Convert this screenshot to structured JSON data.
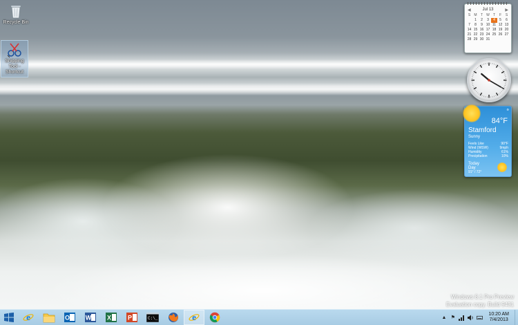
{
  "desktop": {
    "icons": [
      {
        "label": "Recycle Bin",
        "icon": "recycle-bin-icon"
      },
      {
        "label": "Snipping Tool - Shortcut",
        "icon": "snipping-tool-icon"
      }
    ]
  },
  "gadgets": {
    "calendar": {
      "month": "Jul 13",
      "weekdays": [
        "S",
        "M",
        "T",
        "W",
        "T",
        "F",
        "S"
      ],
      "days": [
        "",
        "1",
        "2",
        "3",
        "4",
        "5",
        "6",
        "7",
        "8",
        "9",
        "10",
        "11",
        "12",
        "13",
        "14",
        "15",
        "16",
        "17",
        "18",
        "19",
        "20",
        "21",
        "22",
        "23",
        "24",
        "25",
        "26",
        "27",
        "28",
        "29",
        "30",
        "31",
        "",
        "",
        ""
      ],
      "today": "4",
      "accent": "#e8731a"
    },
    "clock": {
      "hour": 10,
      "minute": 20
    },
    "weather": {
      "temperature": "84°F",
      "city": "Stamford",
      "condition": "Sunny",
      "details": [
        {
          "label": "Feels Like",
          "value": "90°F"
        },
        {
          "label": "Wind (WSW)",
          "value": "9mph"
        },
        {
          "label": "Humidity",
          "value": "61%"
        },
        {
          "label": "Precipitation",
          "value": "10%"
        }
      ],
      "forecast_label": "Today",
      "forecast_sub": "Day",
      "forecast_range": "91° / 72°"
    }
  },
  "watermark": {
    "line1": "Windows 8.1 Pro Preview",
    "line2": "Evaluation copy. Build 9431"
  },
  "taskbar": {
    "start_icon": "windows-logo-icon",
    "pinned": [
      {
        "name": "internet-explorer",
        "icon": "internet-explorer-icon"
      },
      {
        "name": "file-explorer",
        "icon": "folder-icon"
      },
      {
        "name": "outlook",
        "icon": "outlook-icon",
        "letter": "O",
        "color": "#0a64b4"
      },
      {
        "name": "word",
        "icon": "word-icon",
        "letter": "W",
        "color": "#2b579a"
      },
      {
        "name": "excel",
        "icon": "excel-icon",
        "letter": "X",
        "color": "#217346"
      },
      {
        "name": "powerpoint",
        "icon": "powerpoint-icon",
        "letter": "P",
        "color": "#d24726"
      },
      {
        "name": "command-prompt",
        "icon": "command-prompt-icon",
        "letter": "C:\\_"
      },
      {
        "name": "firefox",
        "icon": "firefox-icon"
      },
      {
        "name": "internet-explorer-2",
        "icon": "internet-explorer-icon"
      },
      {
        "name": "chrome",
        "icon": "chrome-icon"
      }
    ],
    "time": "10:20 AM",
    "date": "7/4/2013"
  }
}
